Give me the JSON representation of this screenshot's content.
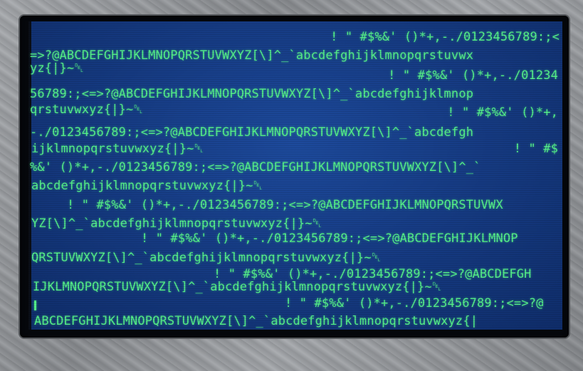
{
  "screen_lines": [
    "! \" #$%&' ()*+,-./0123456789:;<",
    "=>?@ABCDEFGHIJKLMNOPQRSTUVWXYZ[\\]^_`abcdefghijklmnopqrstuvwx",
    "yz{|}~␡",
    "! \" #$%&' ()*+,-./01234",
    "56789:;<=>?@ABCDEFGHIJKLMNOPQRSTUVWXYZ[\\]^_`abcdefghijklmnop",
    "qrstuvwxyz{|}~␡",
    "! \" #$%&' ()*+,",
    "-./0123456789:;<=>?@ABCDEFGHIJKLMNOPQRSTUVWXYZ[\\]^_`abcdefgh",
    "ijklmnopqrstuvwxyz{|}~␡",
    "! \" #$",
    "%&' ()*+,-./0123456789:;<=>?@ABCDEFGHIJKLMNOPQRSTUVWXYZ[\\]^_`",
    "abcdefghijklmnopqrstuvwxyz{|}~␡",
    "! \" #$%&' ()*+,-./0123456789:;<=>?@ABCDEFGHIJKLMNOPQRSTUVWX",
    "YZ[\\]^_`abcdefghijklmnopqrstuvwxyz{|}~␡",
    "! \" #$%&' ()*+,-./0123456789:;<=>?@ABCDEFGHIJKLMNOP",
    "QRSTUVWXYZ[\\]^_`abcdefghijklmnopqrstuvwxyz{|}~␡",
    "! \" #$%&' ()*+,-./0123456789:;<=>?@ABCDEFGH",
    "IJKLMNOPQRSTUVWXYZ[\\]^_`abcdefghijklmnopqrstuvwxyz{|}~␡",
    "! \" #$%&' ()*+,-./0123456789:;<=>?@",
    "ABCDEFGHIJKLMNOPQRSTUVWXYZ[\\]^_`abcdefghijklmnopqrstuvwxyz{|"
  ],
  "colors": {
    "text": "#55f08a",
    "screen_background": "#163c85",
    "bezel": "#8f9296"
  }
}
